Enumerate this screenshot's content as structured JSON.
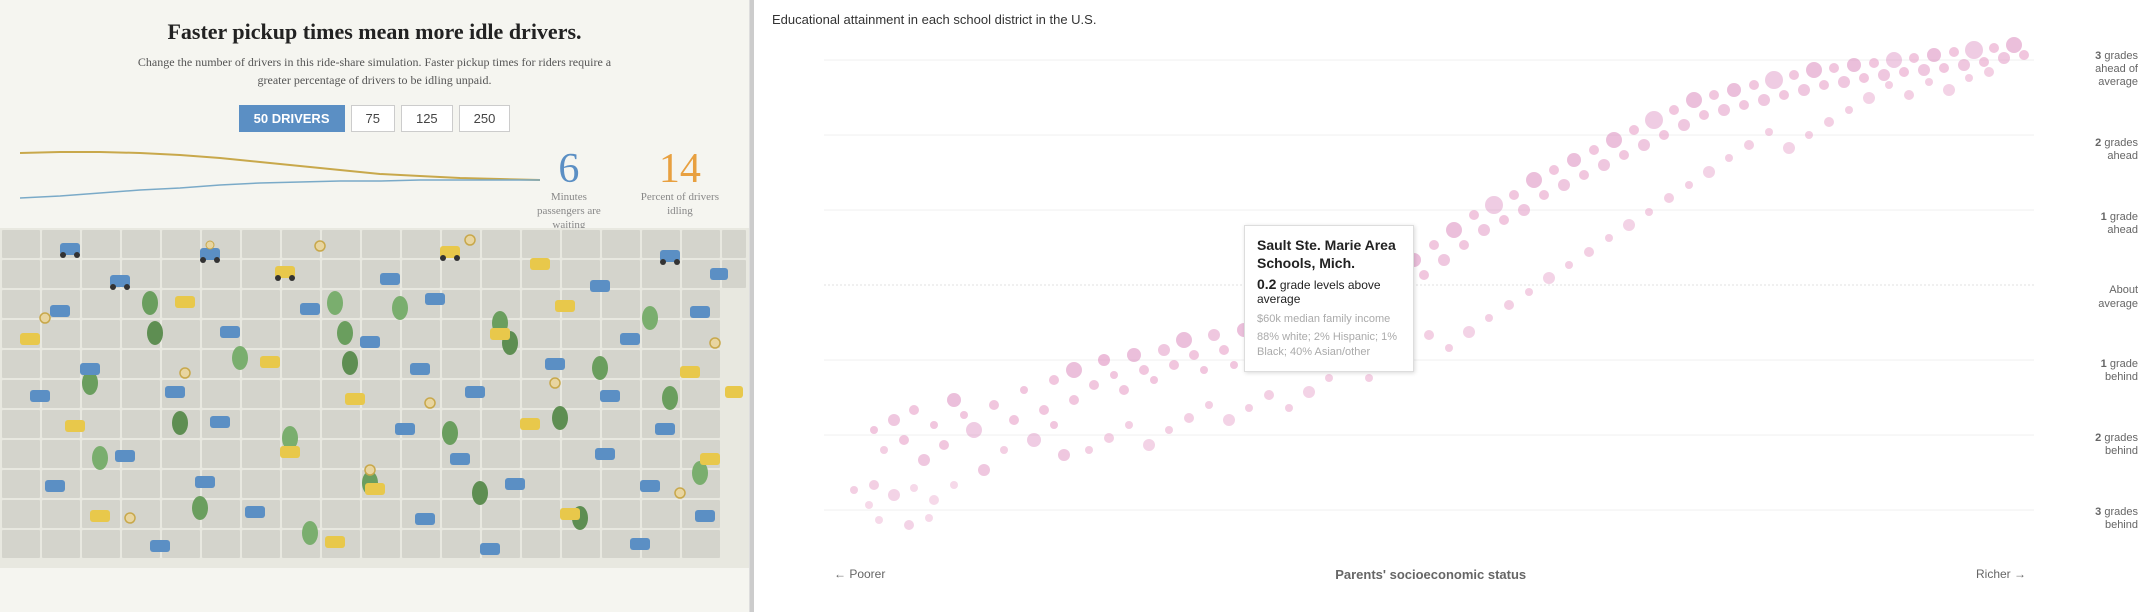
{
  "left": {
    "title": "Faster pickup times mean more idle drivers.",
    "subtitle": "Change the number of drivers in this ride-share simulation. Faster pickup times for riders require a\ngreater percentage of drivers to be idling unpaid.",
    "buttons": [
      {
        "label": "50 DRIVERS",
        "active": true
      },
      {
        "label": "75",
        "active": false
      },
      {
        "label": "125",
        "active": false
      },
      {
        "label": "250",
        "active": false
      }
    ],
    "stat_minutes": "6",
    "stat_minutes_label": "Minutes\npassengers are\nwaiting",
    "stat_percent": "14",
    "stat_percent_label": "Percent of drivers\nidling"
  },
  "right": {
    "title": "Educational attainment in each school district in the U.S.",
    "y_labels": [
      {
        "text": "3 grades\nahead of\naverage"
      },
      {
        "text": "2 grades\nahead"
      },
      {
        "text": "1 grade\nahead"
      },
      {
        "text": "About\naverage"
      },
      {
        "text": "1 grade\nbehind"
      },
      {
        "text": "2 grades\nbehind"
      },
      {
        "text": "3 grades\nbehind"
      }
    ],
    "x_label_left": "← Poorer",
    "x_axis_title": "Parents' socioeconomic status",
    "x_label_right": "Richer →",
    "tooltip": {
      "school": "Sault Ste. Marie Area Schools, Mich.",
      "grade_value": "0.2",
      "grade_label": "grade levels above average",
      "detail1": "$60k median family income",
      "detail2": "88% white; 2% Hispanic; 1% Black; 40% Asian/other"
    }
  }
}
